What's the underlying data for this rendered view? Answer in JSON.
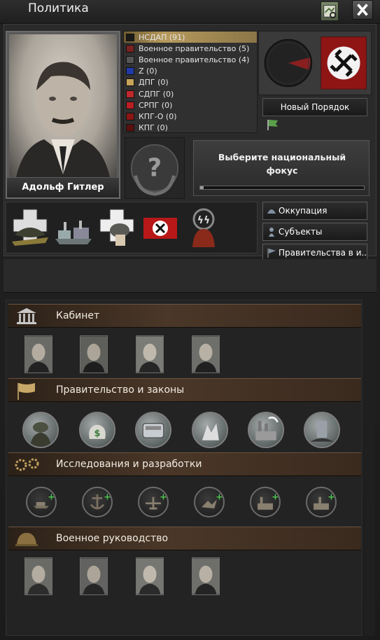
{
  "window": {
    "title": "Политика"
  },
  "leader": {
    "name": "Адольф Гитлер"
  },
  "parties": [
    {
      "label": "НСДАП (91)",
      "color": "#1a1a1a"
    },
    {
      "label": "Военное правительство (5)",
      "color": "#7a2222"
    },
    {
      "label": "Военное правительство (4)",
      "color": "#555555"
    },
    {
      "label": "Z (0)",
      "color": "#1f3aa8"
    },
    {
      "label": "ДПГ (0)",
      "color": "#c7a55a"
    },
    {
      "label": "СДПГ (0)",
      "color": "#c0282d"
    },
    {
      "label": "СРПГ (0)",
      "color": "#b81f22"
    },
    {
      "label": "КПГ-О (0)",
      "color": "#8c1515"
    },
    {
      "label": "КПГ (0)",
      "color": "#5a1010"
    }
  ],
  "ideology": {
    "label": "Новый Порядок"
  },
  "focus": {
    "text": "Выберите национальный фокус",
    "progress": 0.02
  },
  "side_buttons": {
    "occupation": "Оккупация",
    "subjects": "Субъекты",
    "governments": "Правительства в и..."
  },
  "sections": {
    "cabinet": "Кабинет",
    "government_laws": "Правительство и законы",
    "research": "Исследования и разработки",
    "military": "Военное руководство"
  },
  "icons": {
    "map": "map-icon",
    "close": "close-icon",
    "cabinet": "pillars-icon",
    "government": "flag-icon",
    "research": "gears-icon",
    "military": "helmet-icon"
  },
  "colors": {
    "section_header": "#4a3728",
    "accent": "#b79a5c"
  }
}
